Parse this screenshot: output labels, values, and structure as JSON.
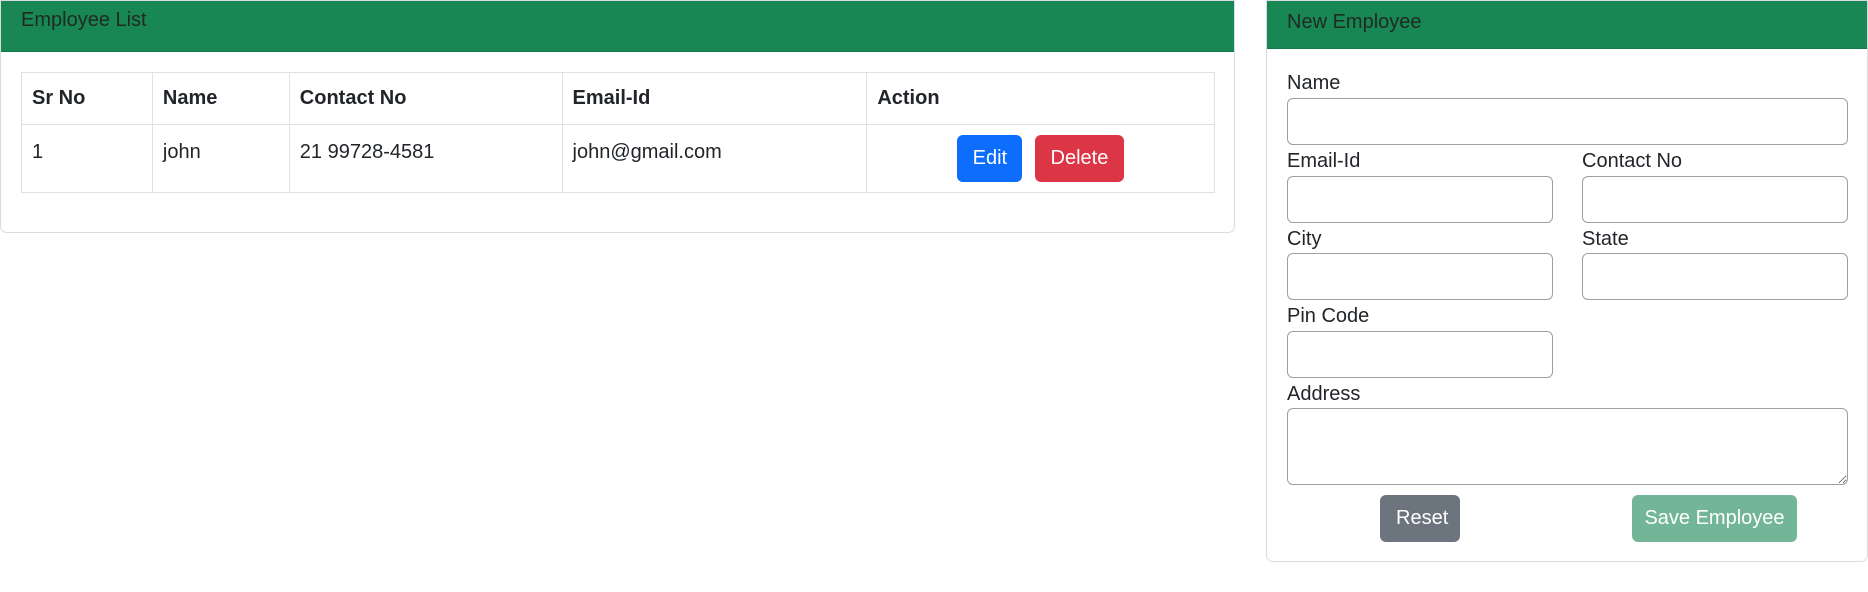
{
  "employee_list": {
    "title": "Employee List",
    "columns": [
      "Sr No",
      "Name",
      "Contact No",
      "Email-Id",
      "Action"
    ],
    "rows": [
      {
        "sr_no": "1",
        "name": "john",
        "contact_no": "21 99728-4581",
        "email": "john@gmail.com",
        "edit_label": "Edit",
        "delete_label": "Delete"
      }
    ]
  },
  "new_employee": {
    "title": "New Employee",
    "fields": {
      "name": {
        "label": "Name",
        "value": ""
      },
      "email": {
        "label": "Email-Id",
        "value": ""
      },
      "contact": {
        "label": "Contact No",
        "value": ""
      },
      "city": {
        "label": "City",
        "value": ""
      },
      "state": {
        "label": "State",
        "value": ""
      },
      "pincode": {
        "label": "Pin Code",
        "value": ""
      },
      "address": {
        "label": "Address",
        "value": ""
      }
    },
    "reset_label": "Reset",
    "save_label": "Save Employee"
  },
  "colors": {
    "header_green": "#198754",
    "edit_blue": "#0d6efd",
    "delete_red": "#dc3545",
    "reset_gray": "#6c757d",
    "save_green_disabled": "#73b697"
  }
}
